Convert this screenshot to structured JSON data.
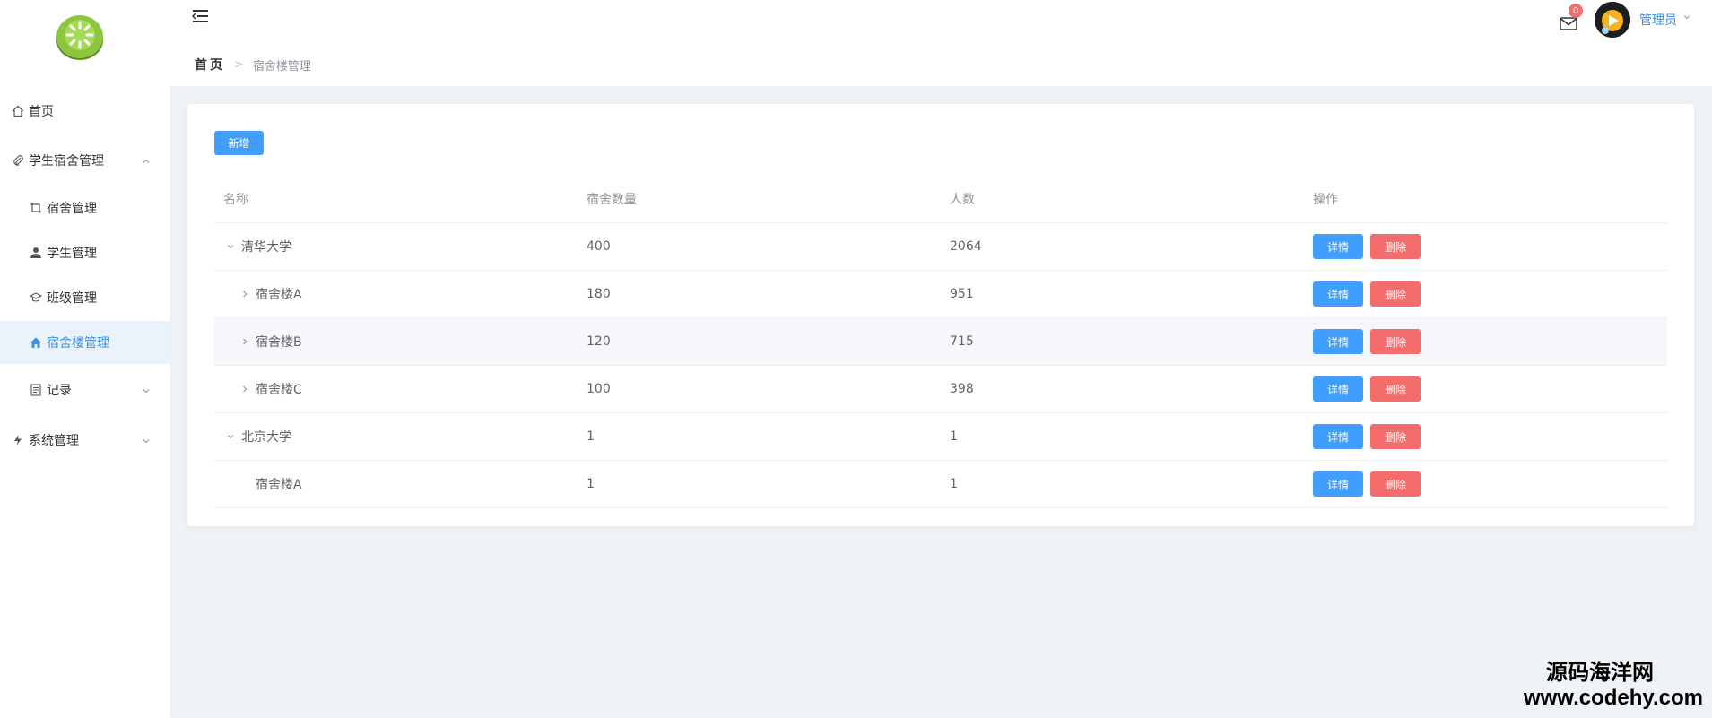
{
  "sidebar": {
    "items": [
      {
        "label": "首页",
        "icon": "home-icon"
      },
      {
        "label": "学生宿舍管理",
        "icon": "paperclip-icon",
        "arrow": "chevron-up-icon"
      },
      {
        "label": "宿舍管理",
        "icon": "crop-icon"
      },
      {
        "label": "学生管理",
        "icon": "user-icon"
      },
      {
        "label": "班级管理",
        "icon": "graduation-cap-icon"
      },
      {
        "label": "宿舍楼管理",
        "icon": "house-icon",
        "active": true
      },
      {
        "label": "记录",
        "icon": "document-icon",
        "arrow": "chevron-down-icon"
      },
      {
        "label": "系统管理",
        "icon": "lightning-icon",
        "arrow": "chevron-down-icon"
      }
    ]
  },
  "header": {
    "breadcrumb": {
      "home": "首页",
      "separator": ">",
      "current": "宿舍楼管理"
    },
    "mail_badge": "0",
    "username": "管理员"
  },
  "toolbar": {
    "add_label": "新增"
  },
  "table": {
    "headers": [
      "名称",
      "宿舍数量",
      "人数",
      "操作"
    ],
    "rows": [
      {
        "name": "清华大学",
        "count": "400",
        "people": "2064",
        "expand": "expanded"
      },
      {
        "name": "宿舍楼A",
        "count": "180",
        "people": "951",
        "expand": "collapsed"
      },
      {
        "name": "宿舍楼B",
        "count": "120",
        "people": "715",
        "expand": "collapsed"
      },
      {
        "name": "宿舍楼C",
        "count": "100",
        "people": "398",
        "expand": "collapsed"
      },
      {
        "name": "北京大学",
        "count": "1",
        "people": "1",
        "expand": "expanded"
      },
      {
        "name": "宿舍楼A",
        "count": "1",
        "people": "1",
        "expand": "none"
      }
    ],
    "detail_label": "详情",
    "delete_label": "删除"
  },
  "watermark": {
    "line1": "源码海洋网",
    "line2": "www.codehy.com"
  },
  "colors": {
    "primary": "#409eff",
    "danger": "#f56c6c",
    "active_bg": "#eaf3fc"
  }
}
